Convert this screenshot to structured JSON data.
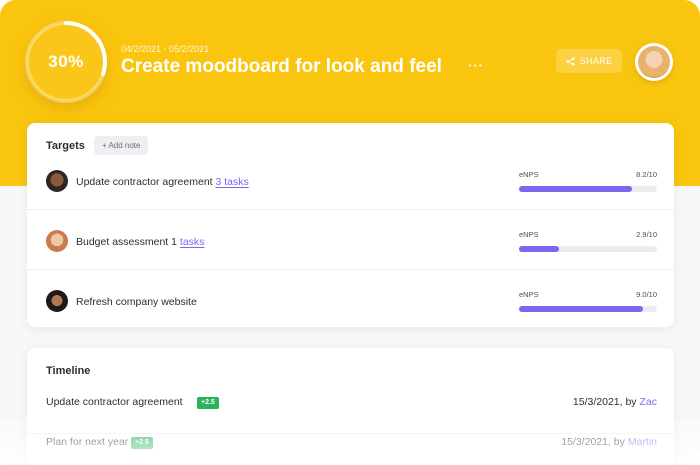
{
  "header": {
    "progress_label": "30%",
    "progress_value": 0.3,
    "date_range": "04/2/2021 - 05/2/2021",
    "title": "Create moodboard for look and feel",
    "more_label": "···",
    "share_label": "SHARE",
    "colors": {
      "banner": "#fac50f"
    }
  },
  "targets": {
    "title": "Targets",
    "add_note_label": "+ Add note",
    "rows": [
      {
        "label": "Update contractor agreement",
        "link_text": "3 tasks",
        "metric_name": "eNPS",
        "metric_value": "8.2/10",
        "fraction": 0.82
      },
      {
        "label": "Budget assessment 1",
        "link_text": "tasks",
        "metric_name": "eNPS",
        "metric_value": "2.9/10",
        "fraction": 0.29
      },
      {
        "label": "Refresh company website",
        "link_text": "",
        "metric_name": "eNPS",
        "metric_value": "9.0/10",
        "fraction": 0.9
      }
    ],
    "colors": {
      "bar": "#7b68ee",
      "link": "#7b68ee"
    }
  },
  "timeline": {
    "title": "Timeline",
    "rows": [
      {
        "label": "Update contractor agreement",
        "badge": "+2.5",
        "date": "15/3/2021, by ",
        "who": "Zac"
      },
      {
        "label": "Plan for next year",
        "badge": "+2.5",
        "date": "15/3/2021, by ",
        "who": "Martin"
      }
    ],
    "colors": {
      "badge": "#2bb35b",
      "who": "#7b68ee"
    }
  }
}
